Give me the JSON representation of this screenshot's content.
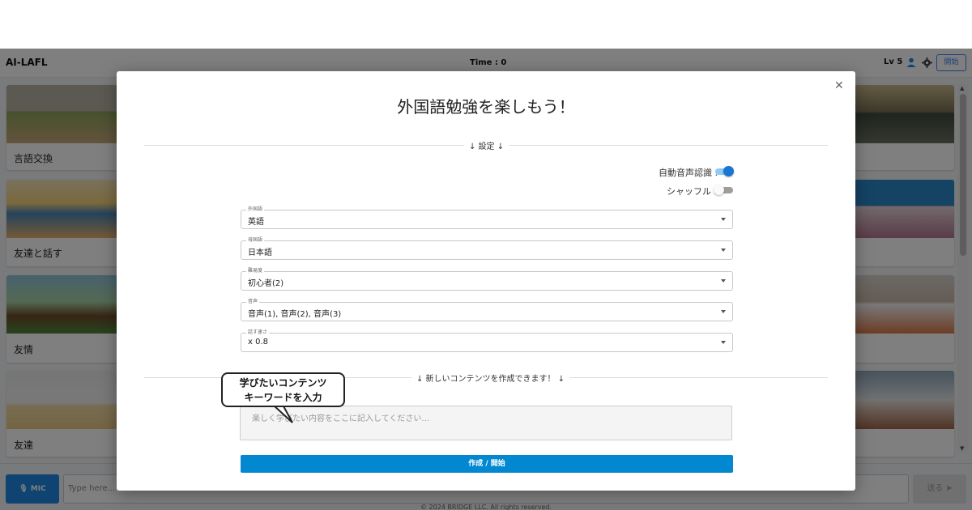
{
  "app": {
    "brand": "AI-LAFL",
    "time": "Time : 0",
    "level": "Lv 5",
    "start_button": "開始",
    "cards_left": [
      {
        "label": "言語交換"
      },
      {
        "label": "友達と話す"
      },
      {
        "label": "友情"
      },
      {
        "label": "友達"
      }
    ],
    "bottom": {
      "mic_label": "MIC",
      "input_placeholder": "Type here...",
      "send_label": "送る",
      "copyright": "© 2024 BRIDGE LLC. All rights reserved."
    }
  },
  "modal": {
    "title": "外国語勉強を楽しもう！",
    "settings_header": "↓ 設定 ↓",
    "auto_speech_label": "自動音声認識 :",
    "auto_speech_on": true,
    "shuffle_label": "シャッフル :",
    "shuffle_on": false,
    "fields": [
      {
        "legend": "外国語",
        "value": "英語"
      },
      {
        "legend": "母国語",
        "value": "日本語"
      },
      {
        "legend": "難易度",
        "value": "初心者(2)"
      },
      {
        "legend": "音声",
        "value": "音声(1), 音声(2), 音声(3)"
      },
      {
        "legend": "話す速さ",
        "value": "x 0.8"
      }
    ],
    "new_content_header": "↓ 新しいコンテンツを作成できます！ ↓",
    "textarea_placeholder": "楽しく学びたい内容をここに記入してください...",
    "create_button": "作成 / 開始",
    "callout_line1": "学びたいコンテンツ",
    "callout_line2": "キーワードを入力"
  },
  "colors": {
    "accent": "#1976d2",
    "create_button": "#0288d1",
    "toggle_on": "#1976d2"
  }
}
